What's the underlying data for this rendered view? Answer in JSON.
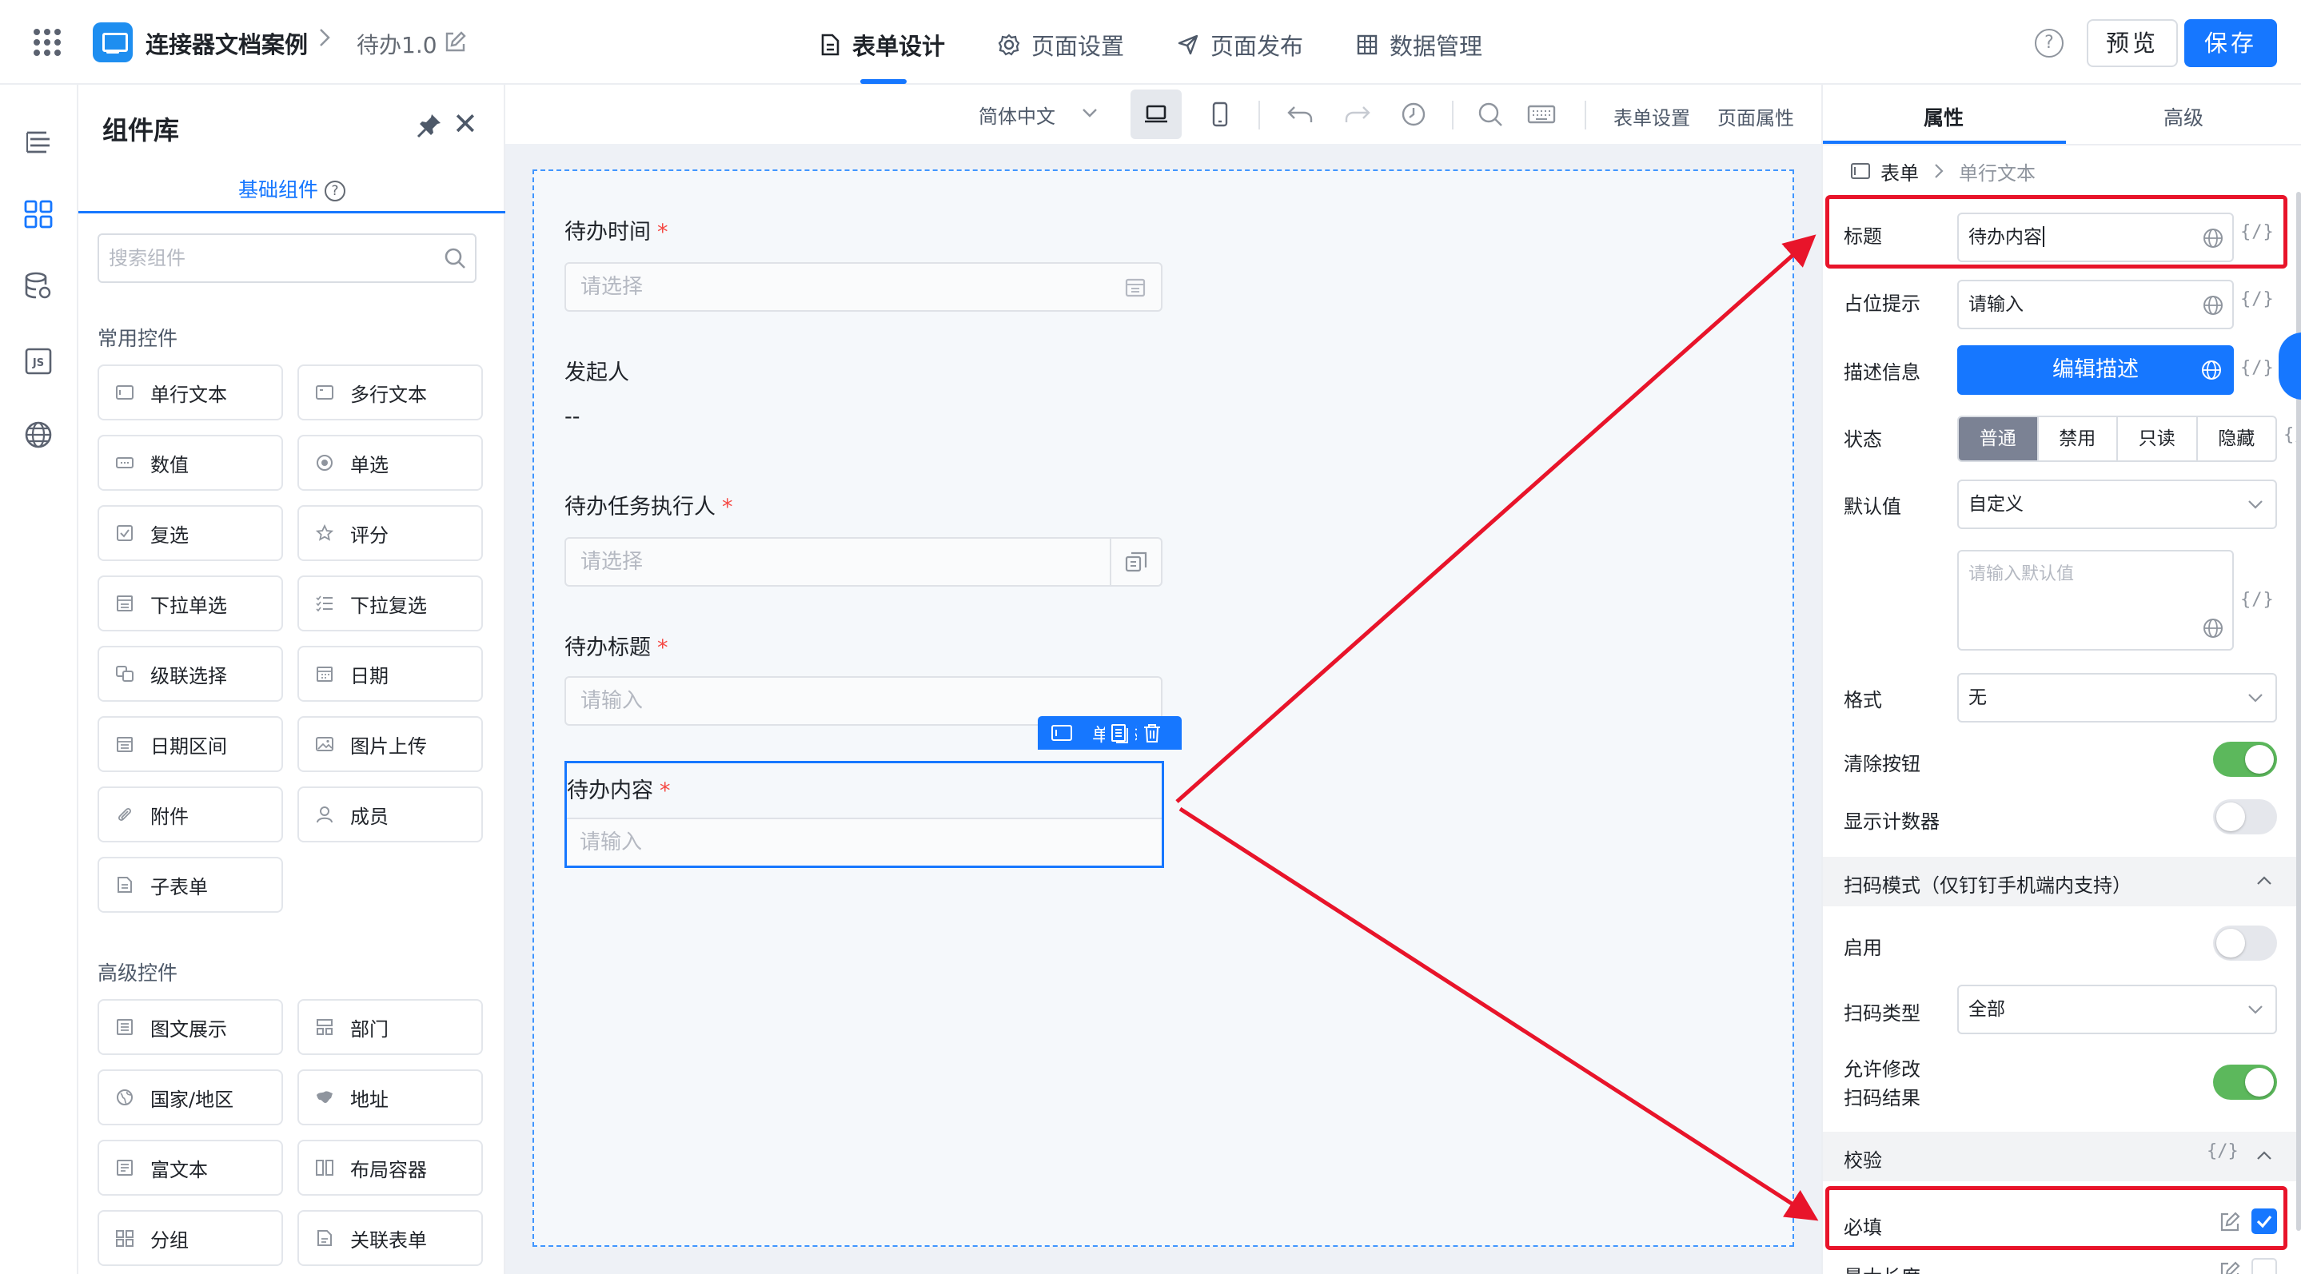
{
  "topbar": {
    "app_name": "连接器文档案例",
    "crumb_sep": ">",
    "page_name": "待办1.0",
    "tabs": [
      {
        "label": "表单设计",
        "icon": "document-icon",
        "active": true
      },
      {
        "label": "页面设置",
        "icon": "gear-icon",
        "active": false
      },
      {
        "label": "页面发布",
        "icon": "send-icon",
        "active": false
      },
      {
        "label": "数据管理",
        "icon": "table-icon",
        "active": false
      }
    ],
    "help": "?",
    "preview": "预览",
    "save": "保存",
    "accent": "#1677ff"
  },
  "library": {
    "title": "组件库",
    "tab": "基础组件",
    "tab_help": "?",
    "search_placeholder": "搜索组件",
    "groups": [
      {
        "title": "常用控件",
        "items": [
          "单行文本",
          "多行文本",
          "数值",
          "单选",
          "复选",
          "评分",
          "下拉单选",
          "下拉复选",
          "级联选择",
          "日期",
          "日期区间",
          "图片上传",
          "附件",
          "成员",
          "子表单"
        ]
      },
      {
        "title": "高级控件",
        "items": [
          "图文展示",
          "部门",
          "国家/地区",
          "地址",
          "富文本",
          "布局容器",
          "分组",
          "关联表单"
        ]
      }
    ]
  },
  "toolbar": {
    "language": "简体中文",
    "form_settings": "表单设置",
    "page_props": "页面属性"
  },
  "form": {
    "fields": [
      {
        "label": "待办时间",
        "required": true,
        "placeholder": "请选择",
        "type": "date"
      },
      {
        "label": "发起人",
        "required": false,
        "value": "--",
        "type": "text"
      },
      {
        "label": "待办任务执行人",
        "required": true,
        "placeholder": "请选择",
        "type": "member"
      },
      {
        "label": "待办标题",
        "required": true,
        "placeholder": "请输入",
        "type": "input"
      },
      {
        "label": "待办内容",
        "required": true,
        "placeholder": "请输入",
        "type": "input",
        "selected": true
      }
    ],
    "selected_tag": "单行文本",
    "required_mark": "*"
  },
  "props": {
    "tabs": [
      "属性",
      "高级"
    ],
    "crumb": [
      "表单",
      "单行文本"
    ],
    "var_label": "{/}",
    "title_label": "标题",
    "title_value": "待办内容",
    "placeholder_label": "占位提示",
    "placeholder_value": "请输入",
    "desc_label": "描述信息",
    "desc_button": "编辑描述",
    "state_label": "状态",
    "states": [
      "普通",
      "禁用",
      "只读",
      "隐藏"
    ],
    "default_label": "默认值",
    "default_value": "自定义",
    "default_placeholder": "请输入默认值",
    "format_label": "格式",
    "format_value": "无",
    "clear_label": "清除按钮",
    "clear_on": true,
    "counter_label": "显示计数器",
    "counter_on": false,
    "scan_section": "扫码模式（仅钉钉手机端内支持）",
    "enable_label": "启用",
    "enable_on": false,
    "scan_type_label": "扫码类型",
    "scan_type_value": "全部",
    "allow_edit_label_1": "允许修改",
    "allow_edit_label_2": "扫码结果",
    "allow_edit_on": true,
    "validate_section": "校验",
    "required_label": "必填",
    "required_checked": true,
    "maxlen_label": "最大长度"
  }
}
